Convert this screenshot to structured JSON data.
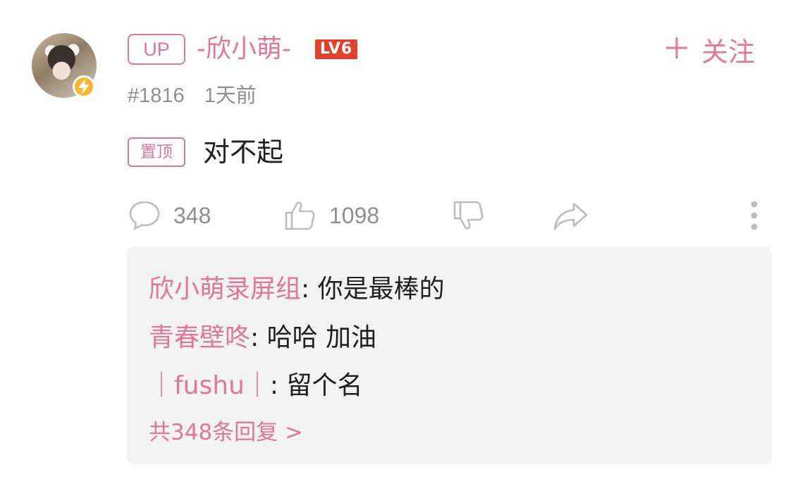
{
  "user": {
    "up_tag": "UP",
    "name": "-欣小萌-",
    "level": "LV6"
  },
  "follow": {
    "label": "关注"
  },
  "meta": {
    "floor": "#1816",
    "time": "1天前"
  },
  "comment": {
    "pinned_tag": "置顶",
    "text": "对不起"
  },
  "actions": {
    "reply_count": "348",
    "like_count": "1098"
  },
  "replies": {
    "items": [
      {
        "author": "欣小萌录屏组",
        "text": ": 你是最棒的"
      },
      {
        "author": "青春壁咚",
        "text": ": 哈哈 加油"
      },
      {
        "author": "｜fushu｜",
        "text": ": 留个名"
      }
    ],
    "more_label": "共348条回复 >"
  },
  "colors": {
    "accent_pink": "#e0769a",
    "level_badge_red": "#e0422e",
    "lightning_badge_yellow": "#f7b531",
    "meta_gray": "#8f8f8f",
    "reply_panel_bg": "#f3f3f3"
  },
  "icons": [
    "lightning-icon",
    "plus-icon",
    "comment-icon",
    "thumbs-up-icon",
    "thumbs-down-icon",
    "share-icon",
    "more-icon"
  ]
}
